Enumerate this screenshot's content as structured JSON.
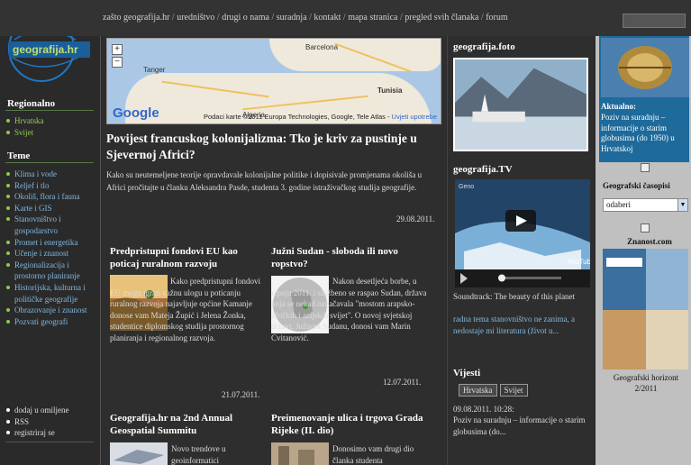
{
  "top_nav": {
    "items": [
      "zašto geografija.hr",
      "uredništvo",
      "drugi o nama",
      "suradnja",
      "kontakt",
      "mapa stranica",
      "pregled svih članaka",
      "forum"
    ],
    "separator": " / "
  },
  "sidebar": {
    "logo_text": "geografija.hr",
    "regional_heading": "Regionalno",
    "regional_items": [
      "Hrvatska",
      "Svijet"
    ],
    "teme_heading": "Teme",
    "teme_items": [
      "Klima i vode",
      "Reljef i tlo",
      "Okoliš, flora i fauna",
      "Karte i GIS",
      "Stanovništvo i gospodarstvo",
      "Promet i energetika",
      "Učenje i znanost",
      "Regionalizacija i prostorno planiranje",
      "Historijska, kulturna i političke geografije",
      "Obrazovanje i znanost",
      "Pozvati geografi"
    ],
    "bottom_items": [
      "dodaj u omiljene",
      "RSS",
      "registriraj se"
    ]
  },
  "map": {
    "labels": [
      "Barcelona",
      "Tunisia",
      "Tanger",
      "Algeria"
    ],
    "attribution": "Podaci karte ©2011 Europa Technologies, Google, Tele Atlas -",
    "terms_link": "Uvjeti upotrebe",
    "google_label": "Google",
    "zoom_in": "+",
    "zoom_out": "−"
  },
  "lead": {
    "title": "Povijest francuskog kolonijalizma: Tko je kriv za pustinje u Sjevernoj Africi?",
    "text": "Kako su neutemeljene teorije opravdavale kolonijalne politike i dopisivale promjenama okoliša u Africi pročitajte u članku Aleksandra Pasde, studenta 3. godine istraživačkog studija geografije.",
    "date": "29.08.2011."
  },
  "articles": [
    {
      "title": "Predpristupni fondovi EU kao poticaj ruralnom razvoju",
      "text": "Kako predpristupni fondovi EU mogu igrati važnu ulogu u poticanju ruralnog razvoja najavljuje općine Kamanje donose vam Mateja Župić i Jelena Žonka, studentice diplomskog studija prostornog planiranja i regionalnog razvoja.",
      "date": "21.07.2011."
    },
    {
      "title": "Južni Sudan - sloboda ili novo ropstvo?",
      "text": "Nakon desetljeća borbe, u srpnju 2011. i službeno se raspao Sudan, država koja se nekad označavala \"mostom arapsko-afričkih i azijskih svijet\". O novoj svjetskoj državi, Južnom Sudanu, donosi vam Marin Cvitanović.",
      "date": "12.07.2011."
    },
    {
      "title": "Geografija.hr na 2nd Annual Geospatial Summitu",
      "text": "Novo trendove u geoinformatici"
    },
    {
      "title": "Preimenovanje ulica i trgova Grada Rijeke (II. dio)",
      "text": "Donosimo vam drugi dio članka studenta"
    }
  ],
  "midcol": {
    "foto_heading": "geografija.foto",
    "tv_heading": "geografija.TV",
    "video_label": "Geno",
    "video_caption": "Soundtrack: The beauty of this planet",
    "youtube_label": "YouTube",
    "forum_link": "radna tema stanovništvo ne zanima, a nedostaje mi literatura (život u...",
    "vijesti_heading": "Vijesti",
    "tabs": [
      "Hrvatska",
      "Svijet"
    ],
    "news_date": "09.08.2011. 10:28:",
    "news_text": "Poziv na suradnju – informacije o starim globusima (do..."
  },
  "rightcol": {
    "aktualno_label": "Aktualno:",
    "aktualno_text": "Poziv na suradnju – informacije o starim globusima (do 1950) u Hrvatskoj",
    "casopis_heading": "Geografski časopisi",
    "select_value": "odaberi",
    "znanost_label": "Znanost.com",
    "magazine_caption": "Geografski horizont 2/2011"
  },
  "colors": {
    "accent_green": "#8fc94f",
    "link_blue": "#7fb8e0",
    "logo_blue": "#1e78c8"
  }
}
